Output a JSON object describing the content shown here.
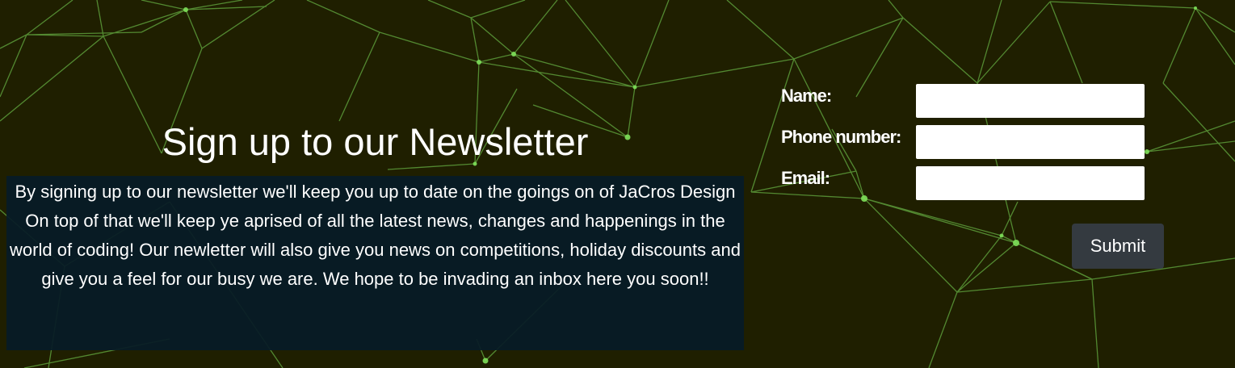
{
  "newsletter": {
    "title": "Sign up to our Newsletter",
    "paragraph_1": "By signing up to our newsletter we'll keep you up to date on the goings on of JaCros Design",
    "paragraph_2": "On top of that we'll keep ye aprised of all the latest news, changes and happenings in the world of coding! Our newletter will also give you news on competitions, holiday discounts and give you a feel for our busy we are. We hope to be invading an inbox here you soon!!"
  },
  "form": {
    "name_label": "Name:",
    "name_value": "",
    "phone_label": "Phone number:",
    "phone_value": "",
    "email_label": "Email:",
    "email_value": "",
    "submit_label": "Submit"
  },
  "colors": {
    "background": "#1f1f00",
    "network_line": "#7ee05a",
    "text_panel": "#071c26",
    "submit_button": "#343a40"
  }
}
